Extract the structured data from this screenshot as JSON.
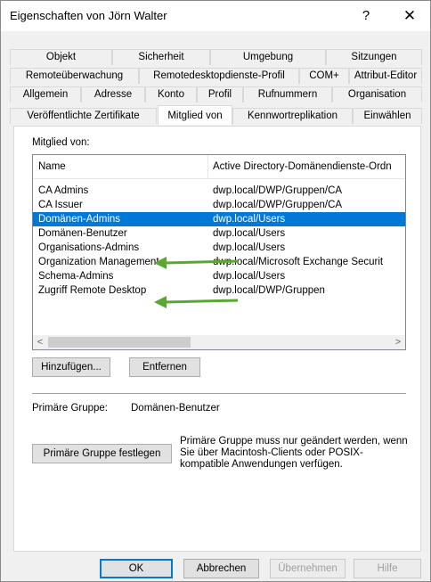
{
  "window": {
    "title": "Eigenschaften von Jörn Walter",
    "help_glyph": "?",
    "close_glyph": "✕"
  },
  "tabs": {
    "row1": [
      "Objekt",
      "Sicherheit",
      "Umgebung",
      "Sitzungen"
    ],
    "row2": [
      "Remoteüberwachung",
      "Remotedesktopdienste-Profil",
      "COM+",
      "Attribut-Editor"
    ],
    "row3": [
      "Allgemein",
      "Adresse",
      "Konto",
      "Profil",
      "Rufnummern",
      "Organisation"
    ],
    "row4": [
      "Veröffentlichte Zertifikate",
      "Mitglied von",
      "Kennwortreplikation",
      "Einwählen"
    ],
    "active": "Mitglied von"
  },
  "member_of": {
    "label": "Mitglied von:",
    "columns": [
      "Name",
      "Active Directory-Domänendienste-Ordn"
    ],
    "rows": [
      {
        "name": "CA Admins",
        "folder": "dwp.local/DWP/Gruppen/CA",
        "selected": false
      },
      {
        "name": "CA Issuer",
        "folder": "dwp.local/DWP/Gruppen/CA",
        "selected": false
      },
      {
        "name": "Domänen-Admins",
        "folder": "dwp.local/Users",
        "selected": true
      },
      {
        "name": "Domänen-Benutzer",
        "folder": "dwp.local/Users",
        "selected": false
      },
      {
        "name": "Organisations-Admins",
        "folder": "dwp.local/Users",
        "selected": false
      },
      {
        "name": "Organization Management",
        "folder": "dwp.local/Microsoft Exchange Securit",
        "selected": false
      },
      {
        "name": "Schema-Admins",
        "folder": "dwp.local/Users",
        "selected": false
      },
      {
        "name": "Zugriff Remote Desktop",
        "folder": "dwp.local/DWP/Gruppen",
        "selected": false
      }
    ],
    "scroll_left_glyph": "<",
    "scroll_right_glyph": ">"
  },
  "buttons": {
    "add": "Hinzufügen...",
    "remove": "Entfernen",
    "set_primary": "Primäre Gruppe festlegen",
    "ok": "OK",
    "cancel": "Abbrechen",
    "apply": "Übernehmen",
    "help": "Hilfe"
  },
  "primary_group": {
    "label": "Primäre Gruppe:",
    "value": "Domänen-Benutzer",
    "note": "Primäre Gruppe muss nur geändert werden, wenn Sie über Macintosh-Clients oder POSIX-kompatible Anwendungen verfügen."
  },
  "colors": {
    "selection": "#0078d7",
    "annotation_arrow": "#5aa832"
  },
  "annotations": {
    "arrows_point_to": [
      "Organisations-Admins",
      "Schema-Admins"
    ]
  }
}
